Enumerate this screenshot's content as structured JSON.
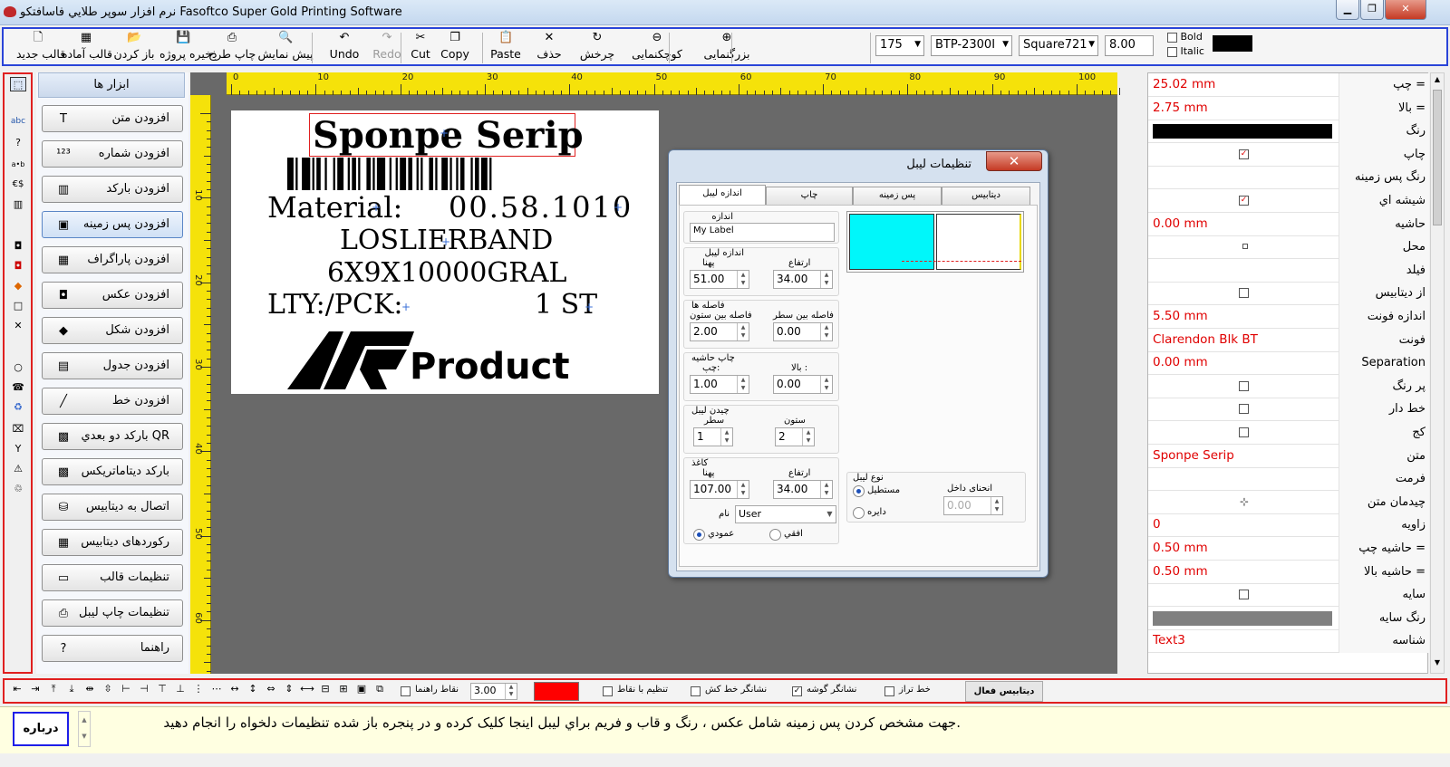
{
  "window": {
    "title": "نرم افزار سوپر طلايي فاسافتکو Fasoftco Super Gold Printing Software"
  },
  "toolbar": {
    "items": [
      {
        "label": "قالب جدید",
        "icon": "new-file-icon"
      },
      {
        "label": "قالب آماده",
        "icon": "template-icon"
      },
      {
        "label": "باز کردن",
        "icon": "open-folder-icon"
      },
      {
        "label": "ذخیره پروژه",
        "icon": "save-icon"
      },
      {
        "label": "چاپ طرح",
        "icon": "printer-icon"
      },
      {
        "label": "پیش نمایش",
        "icon": "preview-icon"
      },
      {
        "label": "Undo",
        "icon": "undo-icon"
      },
      {
        "label": "Redo",
        "icon": "redo-icon"
      },
      {
        "label": "Cut",
        "icon": "scissors-icon"
      },
      {
        "label": "Copy",
        "icon": "copy-icon"
      },
      {
        "label": "Paste",
        "icon": "paste-icon"
      },
      {
        "label": "حذف",
        "icon": "delete-icon"
      },
      {
        "label": "چرخش",
        "icon": "rotate-icon"
      },
      {
        "label": "کوچکنمایی",
        "icon": "zoom-out-icon"
      },
      {
        "label": "بزرگنمایی",
        "icon": "zoom-in-icon"
      }
    ],
    "zoom": "175",
    "printer": "BTP-2300I",
    "font": "Square721",
    "font_size": "8.00",
    "bold": "Bold",
    "italic": "Italic",
    "color": "#000000"
  },
  "tools": {
    "header": "ابزار ها",
    "buttons": [
      "افزودن متن",
      "افزودن شماره",
      "افزودن بارکد",
      "افزودن پس زمینه",
      "افزودن پاراگراف",
      "افزودن  عکس",
      "افزودن  شکل",
      "افزودن  جدول",
      "افزودن  خط",
      "بارکد دو بعدي QR",
      "بارکد دیتاماتریکس",
      "اتصال به دیتابیس",
      "رکوردهای دیتابیس",
      "تنظیمات  قالب",
      "تنظیمات چاپ لیبل",
      "راهنما"
    ]
  },
  "ruler": {
    "top": [
      "0",
      "10",
      "20",
      "30",
      "40",
      "50",
      "60",
      "70",
      "80",
      "90",
      "100"
    ],
    "left": [
      "10",
      "20",
      "30",
      "40",
      "50",
      "60"
    ]
  },
  "label": {
    "title": "Sponpe Serip",
    "material_label": "Material:",
    "material_value": "00.58.1010",
    "line2": "LOSLIERBAND",
    "line3": "6X9X10000GRAL",
    "qty_label": "LTY:/PCK:",
    "qty_value": "1 ST",
    "logo_text": "Product"
  },
  "dialog": {
    "title": "تنظیمات لیبل",
    "tabs": [
      "اندازه لیبل",
      "چاپ",
      "پس زمینه",
      "دیتابیس"
    ],
    "size_group": "اندازه",
    "size_value": "My Label",
    "label_size_group": "اندازه لیبل",
    "width_label": "پهنا",
    "width_value": "51.00",
    "height_label": "ارتفاع",
    "height_value": "34.00",
    "gaps_group": "فاصله ها",
    "col_gap_label": "فاصله بین ستون",
    "col_gap_value": "2.00",
    "row_gap_label": "فاصله بین سطر",
    "row_gap_value": "0.00",
    "margin_group": "چاپ حاشیه",
    "left_label": "چپ:",
    "left_value": "1.00",
    "top_label": "بالا :",
    "top_value": "0.00",
    "layout_group": "چیدن لیبل",
    "rows_label": "سطر",
    "rows_value": "1",
    "cols_label": "ستون",
    "cols_value": "2",
    "paper_group": "کاغذ",
    "paper_width_label": "پهنا",
    "paper_width_value": "107.00",
    "paper_height_label": "ارتفاع",
    "paper_height_value": "34.00",
    "paper_name_label": "نام",
    "paper_name_value": "User",
    "portrait": "عمودي",
    "landscape": "افقي",
    "type_group": "نوع لیبل",
    "rect": "مستطیل",
    "circle": "دایره",
    "corner_label": "انحنای داخل",
    "corner_value": "0.00"
  },
  "properties": [
    {
      "name": "چپ =",
      "value": "25.02 mm"
    },
    {
      "name": "بالا =",
      "value": "2.75 mm"
    },
    {
      "name": "رنگ",
      "value": "",
      "color": "#000000"
    },
    {
      "name": "چاپ",
      "value": "",
      "checked": true
    },
    {
      "name": "رنگ پس زمینه",
      "value": ""
    },
    {
      "name": "شیشه اي",
      "value": "",
      "checked": true
    },
    {
      "name": "حاشیه",
      "value": "0.00 mm"
    },
    {
      "name": "محل",
      "value": ""
    },
    {
      "name": "فیلد",
      "value": ""
    },
    {
      "name": "از دیتابیس",
      "value": "",
      "checked": false
    },
    {
      "name": "اندازه فونت",
      "value": "5.50 mm"
    },
    {
      "name": "فونت",
      "value": "Clarendon Blk BT"
    },
    {
      "name": "Separation",
      "value": "0.00 mm"
    },
    {
      "name": "پر رنگ",
      "value": "",
      "checked": false
    },
    {
      "name": "خط دار",
      "value": "",
      "checked": false
    },
    {
      "name": "کج",
      "value": "",
      "checked": false
    },
    {
      "name": "متن",
      "value": "Sponpe Serip"
    },
    {
      "name": "فرمت",
      "value": ""
    },
    {
      "name": "چیدمان متن",
      "value": ""
    },
    {
      "name": "زاویه",
      "value": "0"
    },
    {
      "name": "حاشیه چپ =",
      "value": "0.50 mm"
    },
    {
      "name": "حاشیه بالا =",
      "value": "0.50 mm"
    },
    {
      "name": "سایه",
      "value": "",
      "checked": false
    },
    {
      "name": "رنگ سایه",
      "value": "",
      "color": "#808080"
    },
    {
      "name": "شناسه",
      "value": "Text3"
    }
  ],
  "bottombar": {
    "guides_label": "نقاط راهنما",
    "guides_value": "3.00",
    "grid_snap": "تنظیم با نقاط",
    "line_marker": "نشانگر خط کش",
    "corner_marker": "نشانگر گوشه",
    "level_line": "خط تراز",
    "active_db": "دیتابیس فعال",
    "swatch": "#ff0000"
  },
  "status": {
    "about": "درباره",
    "hint": "جهت مشخص کردن پس زمینه شامل عکس ، رنگ و قاب و فریم براي لیبل اینجا کلیک کرده و در پنجره باز شده تنظیمات دلخواه را انجام دهید."
  }
}
